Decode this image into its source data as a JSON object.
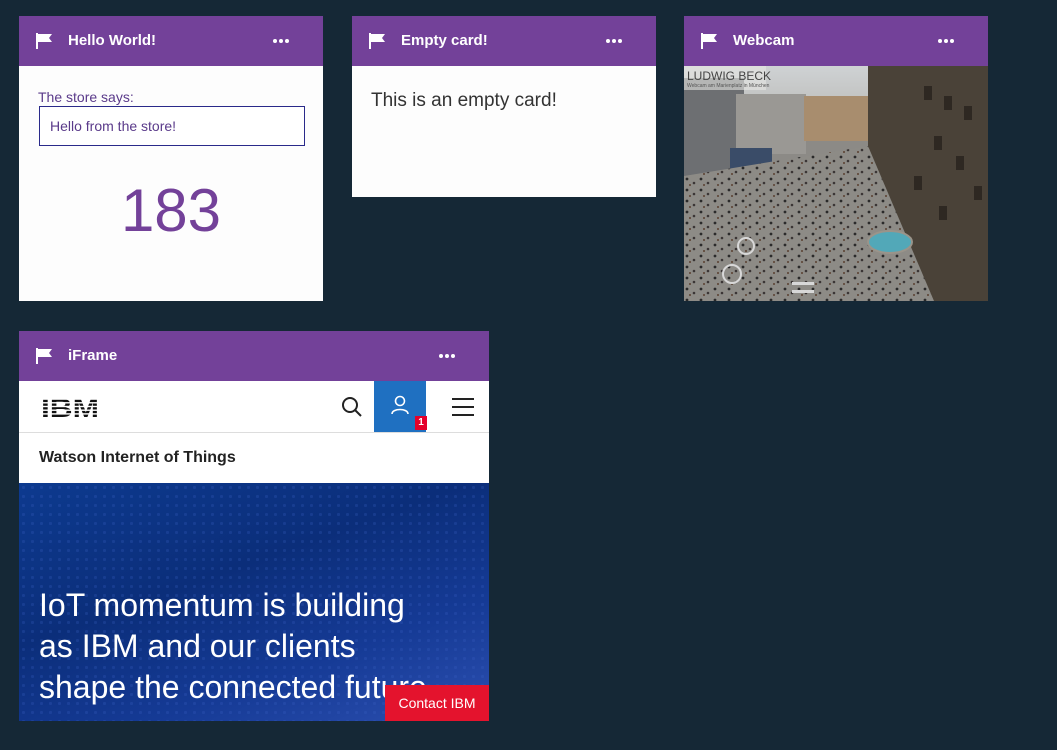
{
  "cards": {
    "hello": {
      "title": "Hello World!",
      "store_label": "The store says:",
      "store_value": "Hello from the store!",
      "counter": "183"
    },
    "empty": {
      "title": "Empty card!",
      "body": "This is an empty card!"
    },
    "webcam": {
      "title": "Webcam",
      "cam_caption": "LUDWIG BECK",
      "cam_subcaption": "Webcam am Marienplatz in München"
    },
    "iframe": {
      "title": "iFrame",
      "site_logo": "IBM",
      "notification_count": "1",
      "subnav_title": "Watson Internet of Things",
      "hero_text": "IoT momentum is building\nas IBM and our clients\nshape the connected future",
      "contact_label": "Contact IBM"
    }
  },
  "colors": {
    "background": "#152836",
    "card_header": "#734199",
    "accent_purple": "#734199",
    "contact_red": "#e4132d",
    "user_blue": "#1f70c1"
  },
  "icons": [
    "flag-icon",
    "more-icon",
    "search-icon",
    "user-icon",
    "menu-icon"
  ]
}
